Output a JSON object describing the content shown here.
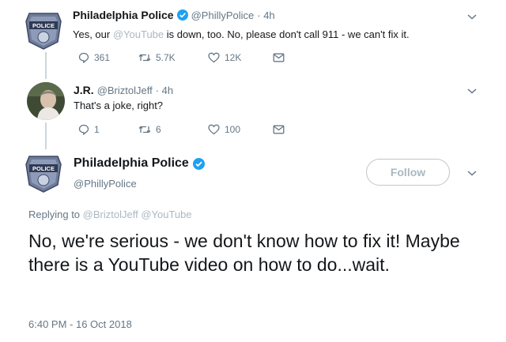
{
  "tweet1": {
    "name": "Philadelphia Police",
    "handle": "@PhillyPolice",
    "time": "· 4h",
    "text_before": "Yes, our",
    "mention": "@YouTube",
    "text_after": "is down, too. No, please don't call 911 - we can't fix it.",
    "replies": "361",
    "retweets": "5.7K",
    "likes": "12K",
    "avatar_text": "POLICE"
  },
  "tweet2": {
    "name": "J.R.",
    "handle": "@BriztolJeff",
    "time": "· 4h",
    "text": "That's a joke, right?",
    "replies": "1",
    "retweets": "6",
    "likes": "100"
  },
  "tweet3": {
    "name": "Philadelphia Police",
    "handle": "@PhillyPolice",
    "follow_label": "Follow",
    "replying_prefix": "Replying to",
    "replying_to": "@BriztolJeff @YouTube",
    "text": "No, we're serious - we don't know how to fix it! Maybe there is a YouTube video on how to do...wait.",
    "timestamp": "6:40 PM - 16 Oct 2018",
    "avatar_text": "POLICE"
  },
  "colors": {
    "verified": "#1da1f2",
    "muted": "#aab8c2",
    "icon": "#657786",
    "line": "#ccd6dd"
  },
  "icons": [
    "verified-badge-icon",
    "chevron-down-icon",
    "reply-icon",
    "retweet-icon",
    "like-icon",
    "dm-icon"
  ]
}
